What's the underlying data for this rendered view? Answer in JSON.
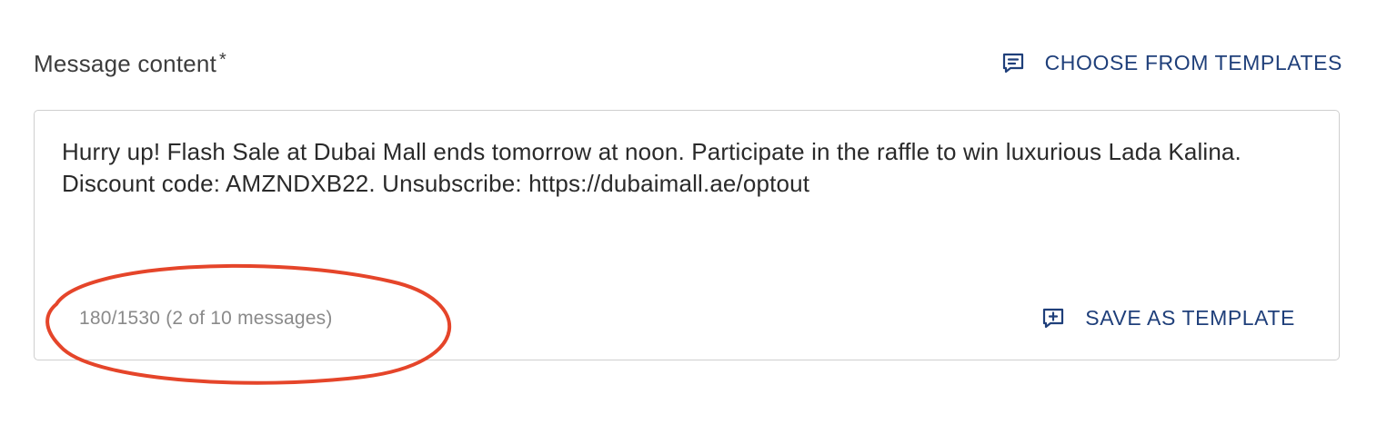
{
  "field": {
    "label": "Message content",
    "required_mark": "*"
  },
  "templates_link": {
    "label": "CHOOSE FROM TEMPLATES",
    "icon": "message-lines-icon"
  },
  "message": {
    "value": "Hurry up! Flash Sale at Dubai Mall ends tomorrow at noon. Participate in the raffle to win luxurious Lada Kalina. Discount code: AMZNDXB22. Unsubscribe: https://dubaimall.ae/optout"
  },
  "counter": {
    "text": "180/1530 (2 of 10 messages)"
  },
  "save_link": {
    "label": "SAVE AS TEMPLATE",
    "icon": "message-plus-icon"
  },
  "colors": {
    "link": "#1f3f7a",
    "annotation": "#e5452a",
    "counter": "#8a8a8a",
    "border": "#cfcfcf"
  }
}
